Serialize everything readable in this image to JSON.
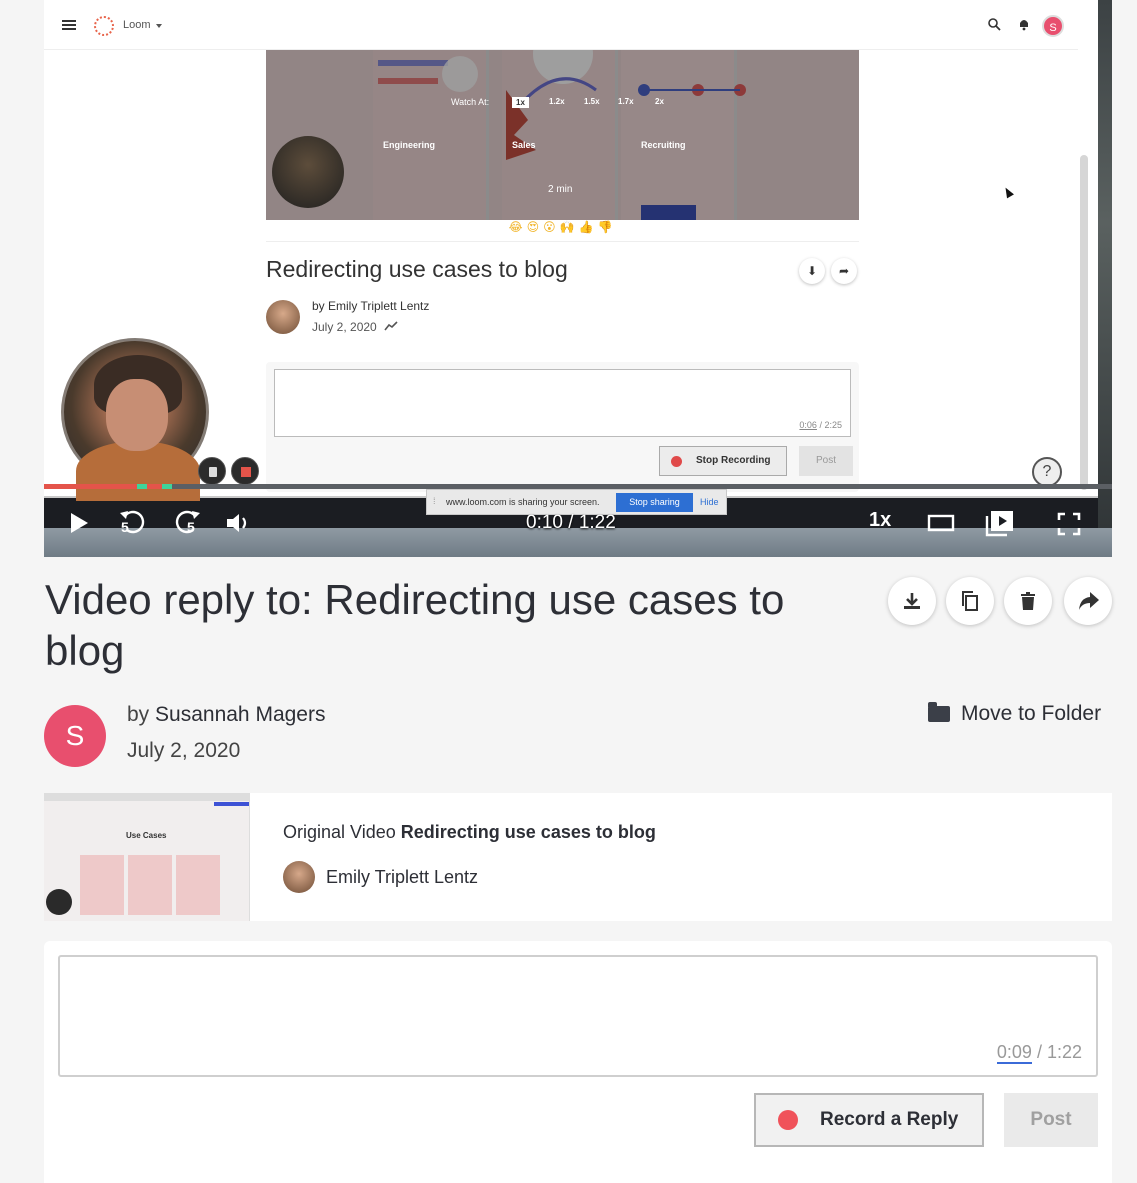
{
  "player": {
    "inner_app": {
      "brand": "Loom",
      "avatar_initial": "S",
      "watch_at_label": "Watch At:",
      "speeds": [
        "1x",
        "1.2x",
        "1.5x",
        "1.7x",
        "2x"
      ],
      "categories": [
        "Engineering",
        "Sales",
        "Recruiting"
      ],
      "duration_label": "2 min",
      "video_title": "Redirecting use cases to blog",
      "author_line": "by Emily Triplett Lentz",
      "date": "July 2, 2020",
      "comment_time": "0:06",
      "comment_total": "/ 2:25",
      "stop_recording_label": "Stop Recording",
      "post_label": "Post",
      "help_label": "?"
    },
    "share_bar": {
      "text": "www.loom.com is sharing your screen.",
      "stop_label": "Stop sharing",
      "hide_label": "Hide"
    },
    "progress": 0.12,
    "rewind_label": "5",
    "forward_label": "5",
    "time_display": "0:10 / 1:22",
    "speed_label": "1x"
  },
  "video": {
    "title": "Video reply to: Redirecting use cases to blog",
    "author_prefix": "by",
    "author": "Susannah Magers",
    "author_initial": "S",
    "date": "July 2, 2020",
    "move_to_folder_label": "Move to Folder"
  },
  "original": {
    "prefix": "Original Video",
    "title": "Redirecting use cases to blog",
    "author": "Emily Triplett Lentz",
    "thumb_heading": "Use Cases"
  },
  "reply": {
    "current_time": "0:09",
    "total_time": "/ 1:22",
    "record_label": "Record a Reply",
    "post_label": "Post"
  },
  "colors": {
    "accent": "#e84f6e",
    "record_dot": "#f0525a",
    "progress": "#e4544a"
  }
}
